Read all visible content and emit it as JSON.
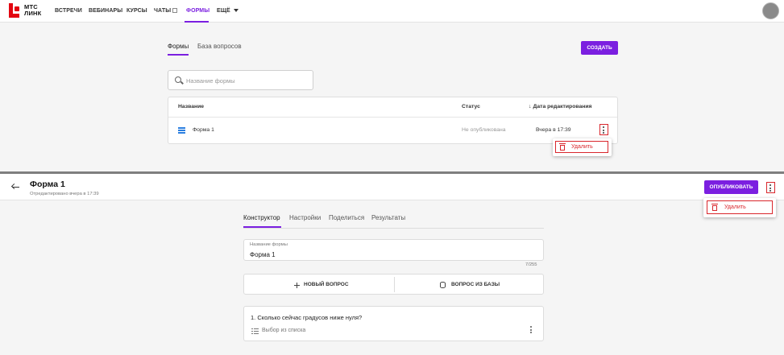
{
  "top": {
    "logo": {
      "line1": "МТС",
      "line2": "ЛИНК"
    },
    "nav": {
      "items": [
        "ВСТРЕЧИ",
        "ВЕБИНАРЫ",
        "КУРСЫ",
        "ЧАТЫ",
        "ФОРМЫ",
        "ЕЩЁ"
      ],
      "active": "ФОРМЫ"
    },
    "tabs": [
      "Формы",
      "База вопросов"
    ],
    "create_label": "СОЗДАТЬ",
    "search": {
      "placeholder": "Название формы",
      "value": ""
    },
    "table": {
      "headers": [
        "Название",
        "Статус",
        "Дата редактирования"
      ],
      "rows": [
        {
          "name": "Форма 1",
          "status": "Не опубликована",
          "date": "Вчера в 17:39"
        }
      ]
    },
    "menu": {
      "delete_label": "Удалить"
    }
  },
  "bottom": {
    "title": "Форма 1",
    "subtitle": "Отредактировано вчера в 17:39",
    "publish_label": "ОПУБЛИКОВАТЬ",
    "menu": {
      "delete_label": "Удалить"
    },
    "tabs": [
      "Конструктор",
      "Настройки",
      "Поделиться",
      "Результаты"
    ],
    "form_name": {
      "label": "Название формы",
      "value": "Форма 1",
      "counter": "7/255"
    },
    "actions": {
      "new_question": "НОВЫЙ ВОПРОС",
      "from_base": "ВОПРОС ИЗ БАЗЫ"
    },
    "question": {
      "text": "1. Сколько сейчас градусов ниже нуля?",
      "type": "Выбор из списка"
    }
  },
  "colors": {
    "accent": "#7b1fe0",
    "brand_red": "#e30611",
    "highlight_red": "#d9262c",
    "list_icon_blue": "#2b7fe0"
  },
  "icons": [
    "logo-mark",
    "external-link-icon",
    "chevron-down-icon",
    "avatar",
    "search-icon",
    "list-icon",
    "sort-down-icon",
    "kebab-icon",
    "trash-icon",
    "arrow-left-icon",
    "plus-icon",
    "database-icon",
    "list-type-icon"
  ]
}
